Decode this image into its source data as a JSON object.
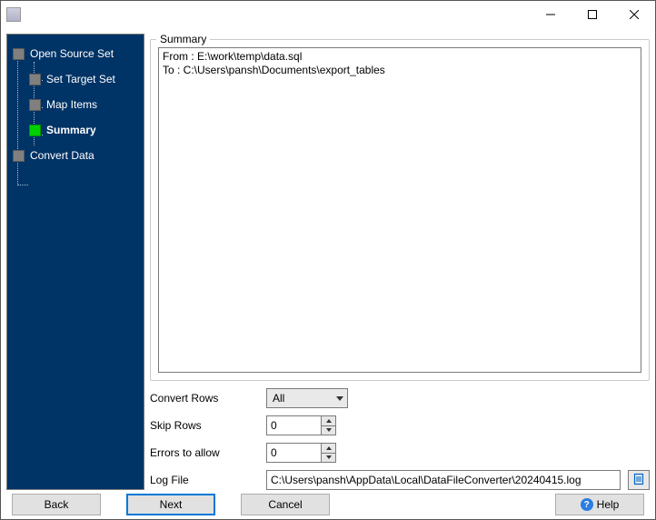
{
  "window": {
    "title": ""
  },
  "sidebar": {
    "steps": [
      {
        "label": "Open Source Set",
        "active": false,
        "child": false
      },
      {
        "label": "Set Target Set",
        "active": false,
        "child": true
      },
      {
        "label": "Map Items",
        "active": false,
        "child": true
      },
      {
        "label": "Summary",
        "active": true,
        "child": true
      },
      {
        "label": "Convert Data",
        "active": false,
        "child": false
      }
    ]
  },
  "main": {
    "summary_label": "Summary",
    "summary_text": "From : E:\\work\\temp\\data.sql\nTo : C:\\Users\\pansh\\Documents\\export_tables",
    "convert_rows": {
      "label": "Convert Rows",
      "value": "All"
    },
    "skip_rows": {
      "label": "Skip Rows",
      "value": "0"
    },
    "errors_allow": {
      "label": "Errors to allow",
      "value": "0"
    },
    "log_file": {
      "label": "Log File",
      "value": "C:\\Users\\pansh\\AppData\\Local\\DataFileConverter\\20240415.log"
    }
  },
  "footer": {
    "back": "Back",
    "next": "Next",
    "cancel": "Cancel",
    "help": "Help"
  }
}
